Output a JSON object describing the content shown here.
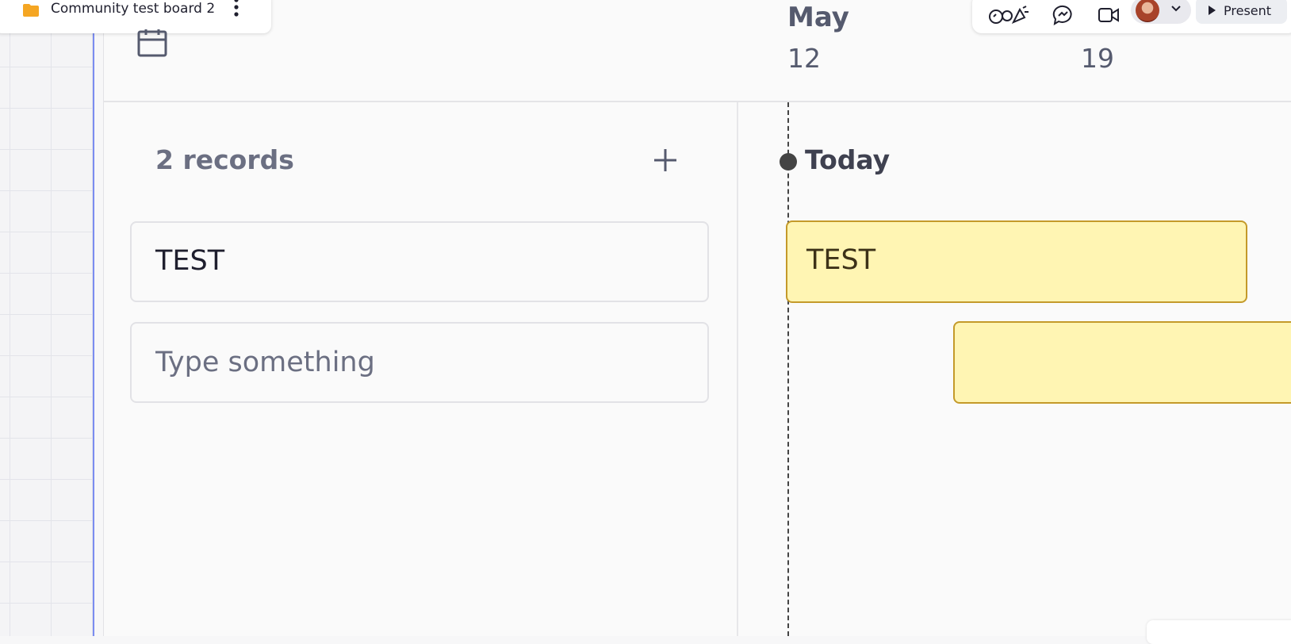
{
  "board": {
    "name": "Community test board 2"
  },
  "toolbar": {
    "present_label": "Present"
  },
  "timeline": {
    "month": "May",
    "days": [
      "12",
      "19"
    ],
    "today_label": "Today"
  },
  "list": {
    "records_label": "2 records",
    "items": [
      {
        "title": "TEST"
      },
      {
        "title": ""
      }
    ],
    "new_item_placeholder": "Type something"
  },
  "bars": [
    {
      "title": "TEST"
    },
    {
      "title": ""
    }
  ],
  "colors": {
    "bar_fill": "#fff5b3",
    "bar_border": "#c49a2a",
    "folder": "#f5a623",
    "frame_accent": "#7b8cf0"
  }
}
